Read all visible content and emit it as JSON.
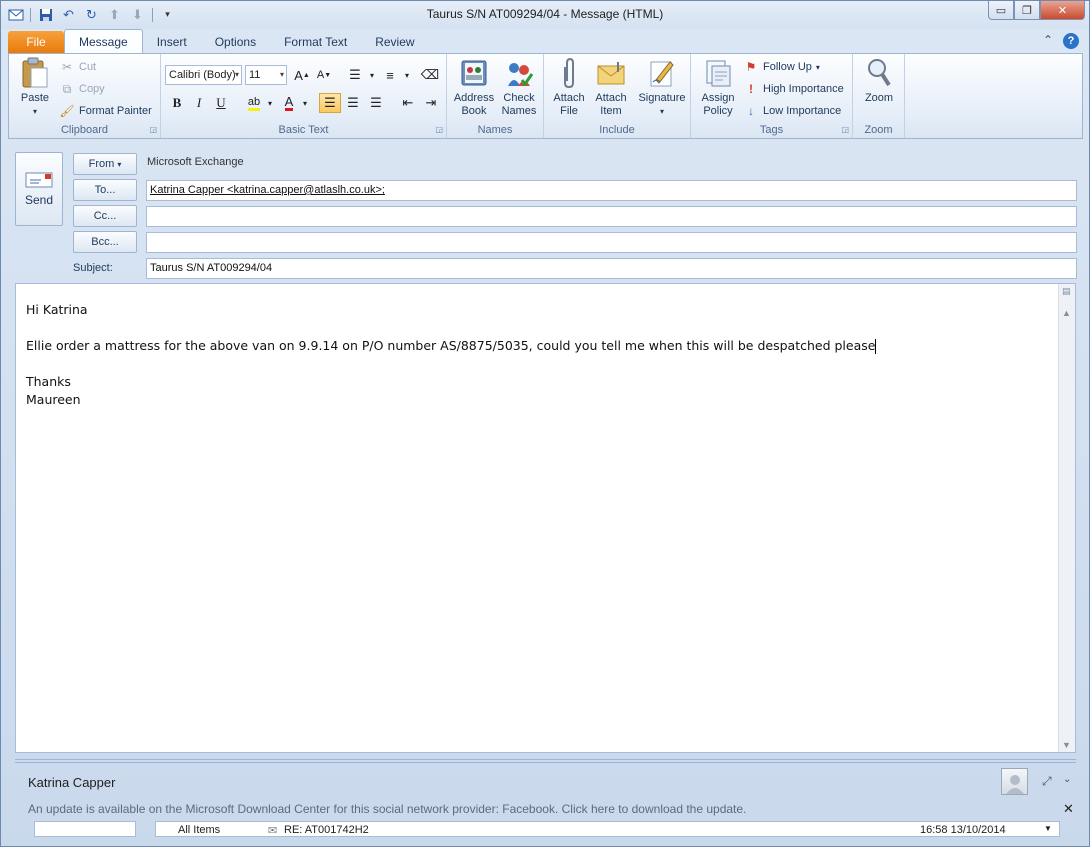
{
  "window": {
    "title": "Taurus  S/N AT009294/04  -  Message (HTML)",
    "controls": {
      "minimize": "▭",
      "restore": "❐",
      "close": "✕"
    }
  },
  "tabs": [
    {
      "label": "File"
    },
    {
      "label": "Message"
    },
    {
      "label": "Insert"
    },
    {
      "label": "Options"
    },
    {
      "label": "Format Text"
    },
    {
      "label": "Review"
    }
  ],
  "ribbon": {
    "clipboard": {
      "label": "Clipboard",
      "paste": "Paste",
      "cut": "Cut",
      "copy": "Copy",
      "format_painter": "Format Painter"
    },
    "basic_text": {
      "label": "Basic Text",
      "font": "Calibri (Body)",
      "size": "11"
    },
    "names": {
      "label": "Names",
      "address_book": "Address Book",
      "check_names": "Check Names"
    },
    "include": {
      "label": "Include",
      "attach_file": "Attach File",
      "attach_item": "Attach Item",
      "signature": "Signature"
    },
    "tags": {
      "label": "Tags",
      "assign_policy": "Assign Policy",
      "follow_up": "Follow Up",
      "high_importance": "High Importance",
      "low_importance": "Low Importance"
    },
    "zoom": {
      "label": "Zoom",
      "zoom": "Zoom"
    }
  },
  "compose": {
    "send": "Send",
    "from_label": "From",
    "from_value": "Microsoft Exchange",
    "to_label": "To...",
    "to_value": "Katrina Capper <katrina.capper@atlaslh.co.uk>;",
    "cc_label": "Cc...",
    "cc_value": "",
    "bcc_label": "Bcc...",
    "bcc_value": "",
    "subject_label": "Subject:",
    "subject_value": "Taurus  S/N AT009294/04"
  },
  "body": {
    "greeting": "Hi Katrina",
    "line1": "Ellie order a mattress for the above van on 9.9.14 on P/O number AS/8875/5035, could you tell me when this will be despatched please",
    "thanks": "Thanks",
    "signature": "Maureen"
  },
  "people_pane": {
    "name": "Katrina Capper",
    "update_message": "An update is available on the Microsoft Download Center for this social network provider: Facebook. Click here to download the update.",
    "feed_filter": "All Items",
    "feed_item": "RE: AT001742H2",
    "feed_time": "16:58  13/10/2014"
  }
}
